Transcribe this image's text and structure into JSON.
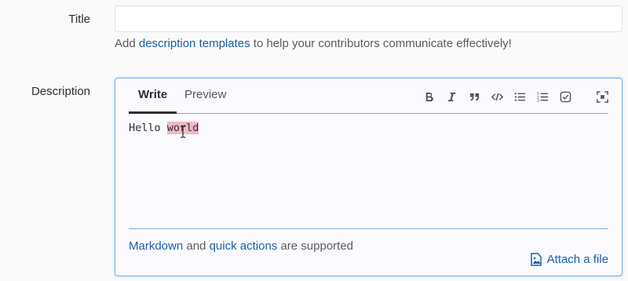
{
  "title_field": {
    "label": "Title",
    "value": "",
    "hint_prefix": "Add ",
    "hint_link": "description templates",
    "hint_suffix": " to help your contributors communicate effectively!"
  },
  "description": {
    "label": "Description",
    "tabs": [
      {
        "label": "Write",
        "active": true
      },
      {
        "label": "Preview",
        "active": false
      }
    ],
    "toolbar_icons": [
      "bold-icon",
      "italic-icon",
      "quote-icon",
      "code-icon",
      "bullet-list-icon",
      "numbered-list-icon",
      "task-list-icon",
      "fullscreen-icon"
    ],
    "text_plain": "Hello ",
    "text_selected": "world",
    "footer_link1": "Markdown",
    "footer_mid": " and ",
    "footer_link2": "quick actions",
    "footer_suffix": " are supported",
    "attach_label": "Attach a file"
  },
  "colors": {
    "link": "#1b5fa7",
    "focus_border": "#73afea",
    "selection": "#f2b7c4"
  }
}
